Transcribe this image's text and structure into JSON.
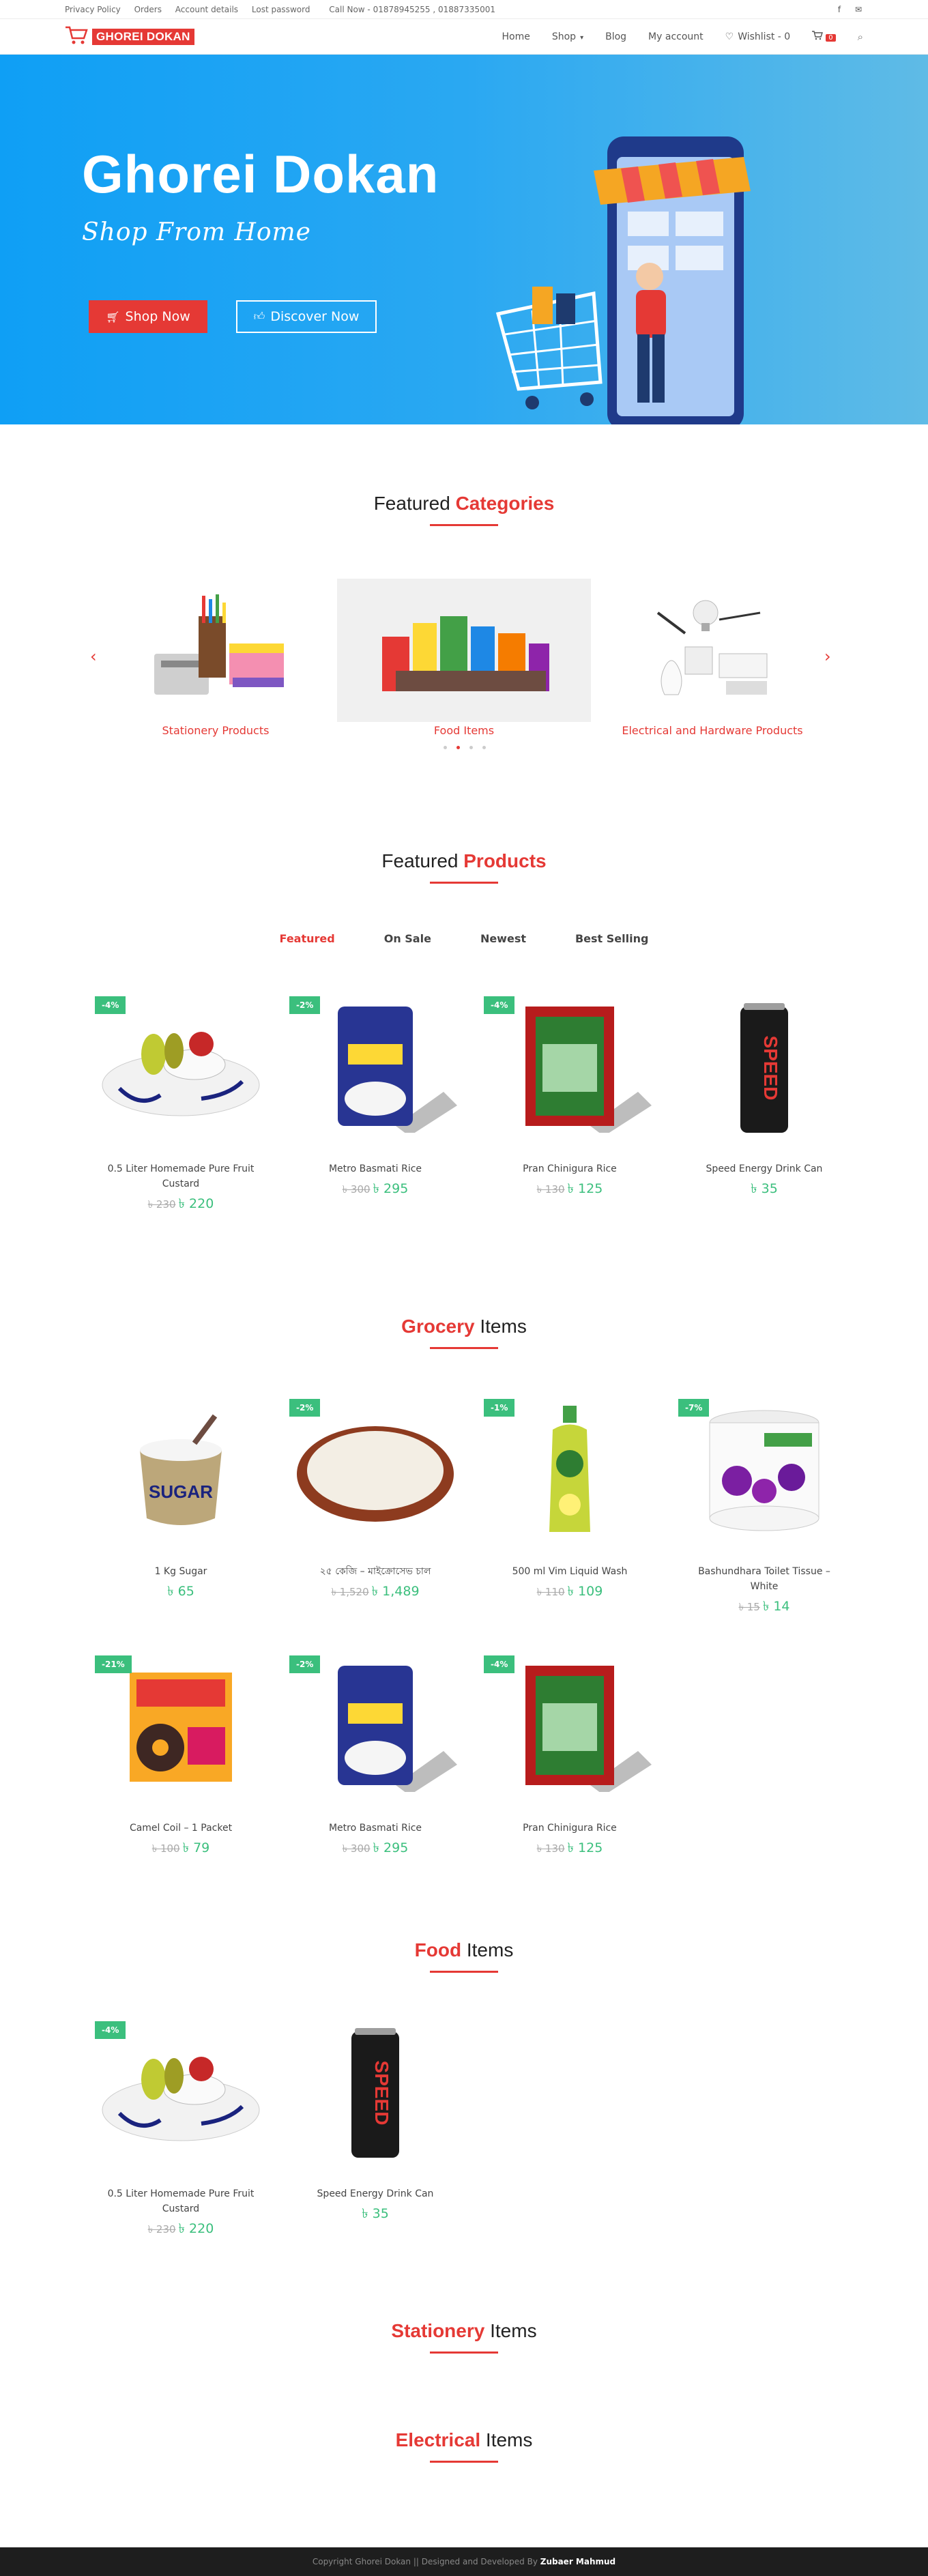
{
  "topbar": {
    "links": [
      "Privacy Policy",
      "Orders",
      "Account details",
      "Lost password"
    ],
    "call": "Call Now - 01878945255 , 01887335001",
    "social": [
      {
        "icon": "facebook-icon",
        "glyph": "f"
      },
      {
        "icon": "mail-icon",
        "glyph": "✉"
      }
    ]
  },
  "header": {
    "logo_text": "GHOREI DOKAN",
    "nav": {
      "home": "Home",
      "shop": "Shop",
      "blog": "Blog",
      "account": "My account",
      "wishlist": "Wishlist - 0",
      "cart_count": "0"
    }
  },
  "hero": {
    "title": "Ghorei Dokan",
    "tagline": "Shop From Home",
    "shop_button": "Shop Now",
    "discover_button": "Discover Now"
  },
  "featured_categories": {
    "title_a": "Featured ",
    "title_b": "Categories",
    "items": [
      "Stationery Products",
      "Food Items",
      "Electrical and Hardware Products"
    ]
  },
  "featured_products": {
    "title_a": "Featured ",
    "title_b": "Products",
    "tabs": [
      "Featured",
      "On Sale",
      "Newest",
      "Best Selling"
    ],
    "items": [
      {
        "discount": "-4%",
        "name": "0.5 Liter Homemade Pure Fruit Custard",
        "old": "৳ 230",
        "price": "৳ 220"
      },
      {
        "discount": "-2%",
        "name": "Metro Basmati Rice",
        "old": "৳ 300",
        "price": "৳ 295"
      },
      {
        "discount": "-4%",
        "name": "Pran Chinigura Rice",
        "old": "৳ 130",
        "price": "৳ 125"
      },
      {
        "discount": "",
        "name": "Speed Energy Drink Can",
        "old": "",
        "price": "৳ 35"
      }
    ]
  },
  "grocery": {
    "title_a": "Grocery",
    "title_b": " Items",
    "items": [
      {
        "discount": "",
        "name": "1 Kg Sugar",
        "old": "",
        "price": "৳ 65"
      },
      {
        "discount": "-2%",
        "name": "২৫ কেজি – মাইক্রোসেভ চাল",
        "old": "৳ 1,520",
        "price": "৳ 1,489"
      },
      {
        "discount": "-1%",
        "name": "500 ml Vim Liquid Wash",
        "old": "৳ 110",
        "price": "৳ 109"
      },
      {
        "discount": "-7%",
        "name": "Bashundhara Toilet Tissue – White",
        "old": "৳ 15",
        "price": "৳ 14"
      },
      {
        "discount": "-21%",
        "name": "Camel Coil – 1 Packet",
        "old": "৳ 100",
        "price": "৳ 79"
      },
      {
        "discount": "-2%",
        "name": "Metro Basmati Rice",
        "old": "৳ 300",
        "price": "৳ 295"
      },
      {
        "discount": "-4%",
        "name": "Pran Chinigura Rice",
        "old": "৳ 130",
        "price": "৳ 125"
      }
    ]
  },
  "food": {
    "title_a": "Food",
    "title_b": " Items",
    "items": [
      {
        "discount": "-4%",
        "name": "0.5 Liter Homemade Pure Fruit Custard",
        "old": "৳ 230",
        "price": "৳ 220"
      },
      {
        "discount": "",
        "name": "Speed Energy Drink Can",
        "old": "",
        "price": "৳ 35"
      }
    ]
  },
  "stationery": {
    "title_a": "Stationery",
    "title_b": " Items"
  },
  "electrical": {
    "title_a": "Electrical",
    "title_b": " Items"
  },
  "footer": {
    "text": "Copyright Ghorei Dokan || Designed and Developed By ",
    "author": "Zubaer Mahmud"
  },
  "colors": {
    "accent": "#e53935",
    "sale": "#3bbf7d",
    "hero": "#0f9ff5"
  }
}
